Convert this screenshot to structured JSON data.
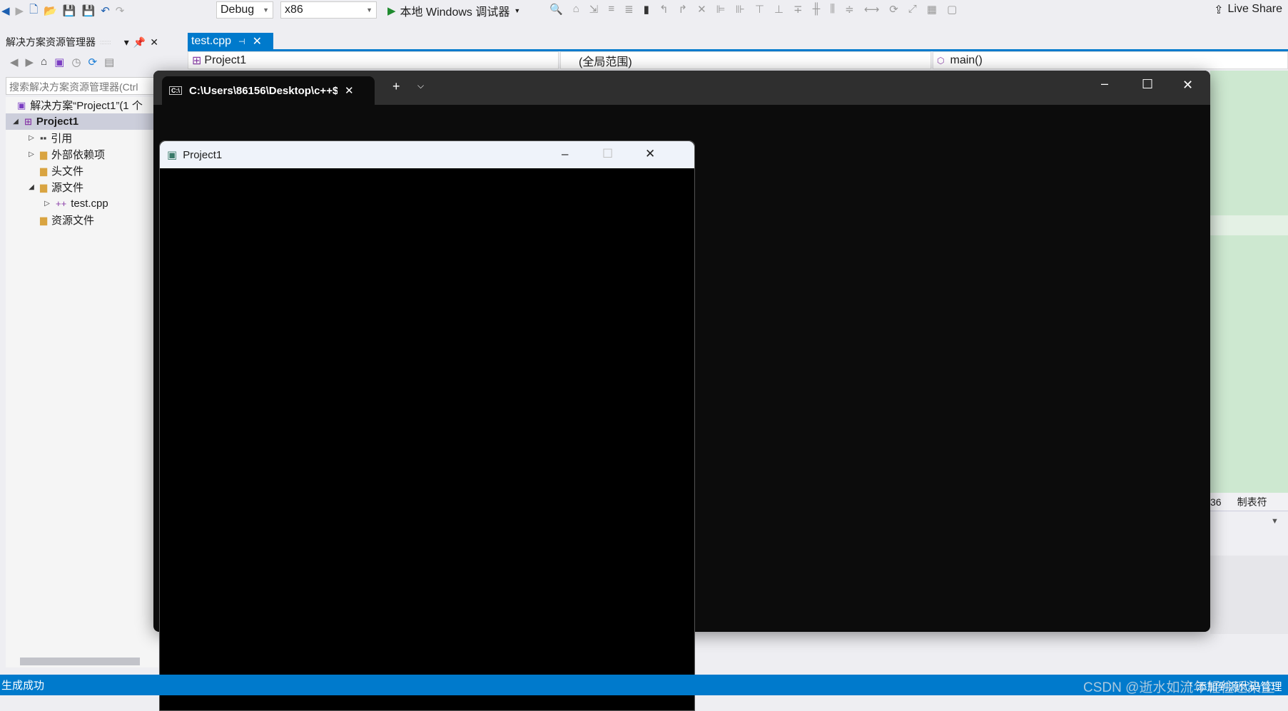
{
  "toolbar": {
    "config": "Debug",
    "platform": "x86",
    "run_label": "本地 Windows 调试器",
    "live_share": "Live Share"
  },
  "solution_explorer": {
    "title": "解决方案资源管理器",
    "search_placeholder": "搜索解决方案资源管理器(Ctrl",
    "items": [
      {
        "label": "解决方案“Project1”(1 个"
      },
      {
        "label": "Project1"
      },
      {
        "label": "引用"
      },
      {
        "label": "外部依赖项"
      },
      {
        "label": "头文件"
      },
      {
        "label": "源文件"
      },
      {
        "label": "test.cpp"
      },
      {
        "label": "资源文件"
      }
    ]
  },
  "editor": {
    "tab": "test.cpp",
    "nav_project": "Project1",
    "nav_scope": "(全局范围)",
    "nav_member": "main()",
    "status_col": "36",
    "status_tab": "制表符"
  },
  "terminal": {
    "tab_title": "C:\\Users\\86156\\Desktop\\c++$"
  },
  "app_window": {
    "title": "Project1"
  },
  "statusbar": {
    "left": "生成成功",
    "right": "添加到源代码管理",
    "watermark": "CSDN @逝水如流年轻往返染尘"
  },
  "colors": {
    "accent": "#007acc",
    "editor_bg": "#cde8d0"
  }
}
